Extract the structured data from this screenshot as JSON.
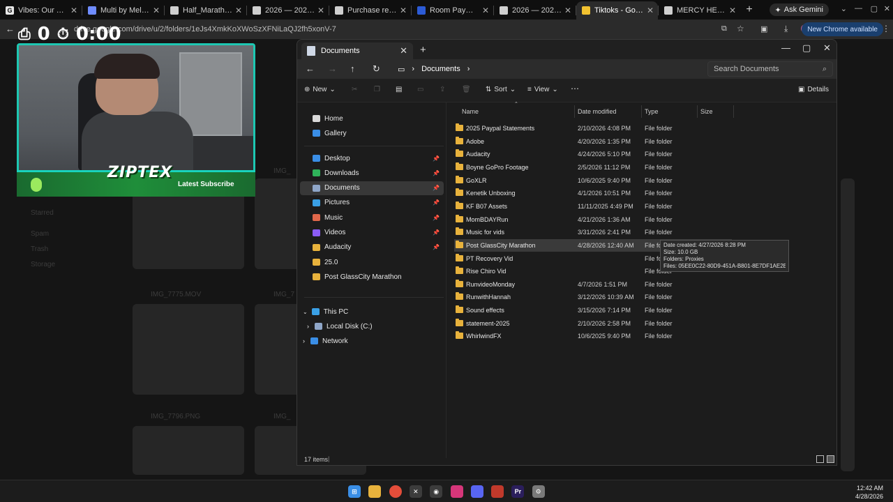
{
  "browser": {
    "tabs": [
      {
        "title": "Vibes: Our Themed",
        "fav_color": "#e8e8e8",
        "fav_letter": "G"
      },
      {
        "title": "Multi by Meld - Da",
        "fav_color": "#6f8cff",
        "fav_letter": ""
      },
      {
        "title": "Half_Marathon_Ele",
        "fav_color": "#cfcfcf",
        "fav_letter": ""
      },
      {
        "title": "2026 — 2026 DICK",
        "fav_color": "#cfcfcf",
        "fav_letter": ""
      },
      {
        "title": "Purchase refund p",
        "fav_color": "#cfcfcf",
        "fav_letter": ""
      },
      {
        "title": "Room Payment - D",
        "fav_color": "#2c5bd6",
        "fav_letter": ""
      },
      {
        "title": "2026 — 2026 DICK",
        "fav_color": "#cfcfcf",
        "fav_letter": ""
      },
      {
        "title": "Tiktoks - Google D",
        "fav_color": "#f2c230",
        "fav_letter": ""
      },
      {
        "title": "MERCY HEALTH GL",
        "fav_color": "#cfcfcf",
        "fav_letter": ""
      }
    ],
    "active_tab": 7,
    "ask_gemini": "Ask Gemini",
    "url": "drive.google.com/drive/u/2/folders/1eJs4XmkKoXWoSzXFNiLaQJ2fh5xonV-7",
    "new_chrome": "New Chrome available"
  },
  "stream": {
    "counter": "0",
    "timer": "0:00",
    "brand": "ZIPTEX",
    "latest_subscribe": "Latest Subscribe"
  },
  "background_page": {
    "labels": [
      "IMG_",
      "Starred",
      "Spam",
      "Trash",
      "Storage",
      "IMG_7775.MOV",
      "IMG_7",
      "IMG_7796.PNG",
      "IMG_"
    ]
  },
  "explorer": {
    "tab_title": "Documents",
    "breadcrumb": "Documents",
    "search_placeholder": "Search Documents",
    "commands": {
      "new": "New",
      "sort": "Sort",
      "view": "View",
      "details": "Details"
    },
    "nav": {
      "home": "Home",
      "gallery": "Gallery",
      "pinned": [
        {
          "label": "Desktop",
          "color": "#3a8ee6"
        },
        {
          "label": "Downloads",
          "color": "#2fb35a"
        },
        {
          "label": "Documents",
          "color": "#8fa6c8"
        },
        {
          "label": "Pictures",
          "color": "#3aa0e6"
        },
        {
          "label": "Music",
          "color": "#e0674a"
        },
        {
          "label": "Videos",
          "color": "#8b5cf6"
        },
        {
          "label": "Audacity",
          "color": "#e8b23c"
        },
        {
          "label": "25.0",
          "color": "#e8b23c"
        },
        {
          "label": "Post GlassCity Marathon",
          "color": "#e8b23c"
        }
      ],
      "this_pc": "This PC",
      "local_disk": "Local Disk (C:)",
      "network": "Network"
    },
    "columns": {
      "name": "Name",
      "date": "Date modified",
      "type": "Type",
      "size": "Size"
    },
    "files": [
      {
        "name": "2025 Paypal Statements",
        "date": "2/10/2026 4:08 PM",
        "type": "File folder"
      },
      {
        "name": "Adobe",
        "date": "4/20/2026 1:35 PM",
        "type": "File folder"
      },
      {
        "name": "Audacity",
        "date": "4/24/2026 5:10 PM",
        "type": "File folder"
      },
      {
        "name": "Boyne GoPro Footage",
        "date": "2/5/2026 11:12 PM",
        "type": "File folder"
      },
      {
        "name": "GoXLR",
        "date": "10/6/2025 9:40 PM",
        "type": "File folder"
      },
      {
        "name": "Kenetik Unboxing",
        "date": "4/1/2026 10:51 PM",
        "type": "File folder"
      },
      {
        "name": "KF B07 Assets",
        "date": "11/11/2025 4:49 PM",
        "type": "File folder"
      },
      {
        "name": "MomBDAYRun",
        "date": "4/21/2026 1:36 AM",
        "type": "File folder"
      },
      {
        "name": "Music for vids",
        "date": "3/31/2026 2:41 PM",
        "type": "File folder"
      },
      {
        "name": "Post GlassCity Marathon",
        "date": "4/28/2026 12:40 AM",
        "type": "File folder"
      },
      {
        "name": "PT Recovery Vid",
        "date": "",
        "type": "File folder"
      },
      {
        "name": "Rise Chiro Vid",
        "date": "",
        "type": "File folder"
      },
      {
        "name": "RunvideoMonday",
        "date": "4/7/2026 1:51 PM",
        "type": "File folder"
      },
      {
        "name": "RunwithHannah",
        "date": "3/12/2026 10:39 AM",
        "type": "File folder"
      },
      {
        "name": "Sound effects",
        "date": "3/15/2026 7:14 PM",
        "type": "File folder"
      },
      {
        "name": "statement-2025",
        "date": "2/10/2026 2:58 PM",
        "type": "File folder"
      },
      {
        "name": "WhirlwindFX",
        "date": "10/6/2025 9:40 PM",
        "type": "File folder"
      }
    ],
    "highlighted_row": 9,
    "tooltip": {
      "line1": "Date created: 4/27/2026 8:28 PM",
      "line2": "Size: 10.0 GB",
      "line3": "Folders: Proxies",
      "line4": "Files: 05EE0C22-80D9-451A-B801-8E7DF1AE2EBC, ..."
    },
    "status": "17 items"
  },
  "taskbar": {
    "time": "12:42 AM",
    "date": "4/28/2026",
    "apps": [
      {
        "name": "start",
        "color": "#3a8ee6",
        "glyph": "⊞"
      },
      {
        "name": "explorer",
        "color": "#e8b23c",
        "glyph": ""
      },
      {
        "name": "chrome",
        "color": "#e44d3a",
        "glyph": ""
      },
      {
        "name": "app-x",
        "color": "#3c3c3c",
        "glyph": "✕"
      },
      {
        "name": "app-o",
        "color": "#3c3c3c",
        "glyph": "◉"
      },
      {
        "name": "instagram",
        "color": "#d6367a",
        "glyph": ""
      },
      {
        "name": "discord",
        "color": "#5865f2",
        "glyph": ""
      },
      {
        "name": "app-red",
        "color": "#c0392b",
        "glyph": ""
      },
      {
        "name": "premiere",
        "color": "#2b1e5c",
        "glyph": "Pr"
      },
      {
        "name": "settings",
        "color": "#7a7a7a",
        "glyph": "⚙"
      }
    ]
  }
}
